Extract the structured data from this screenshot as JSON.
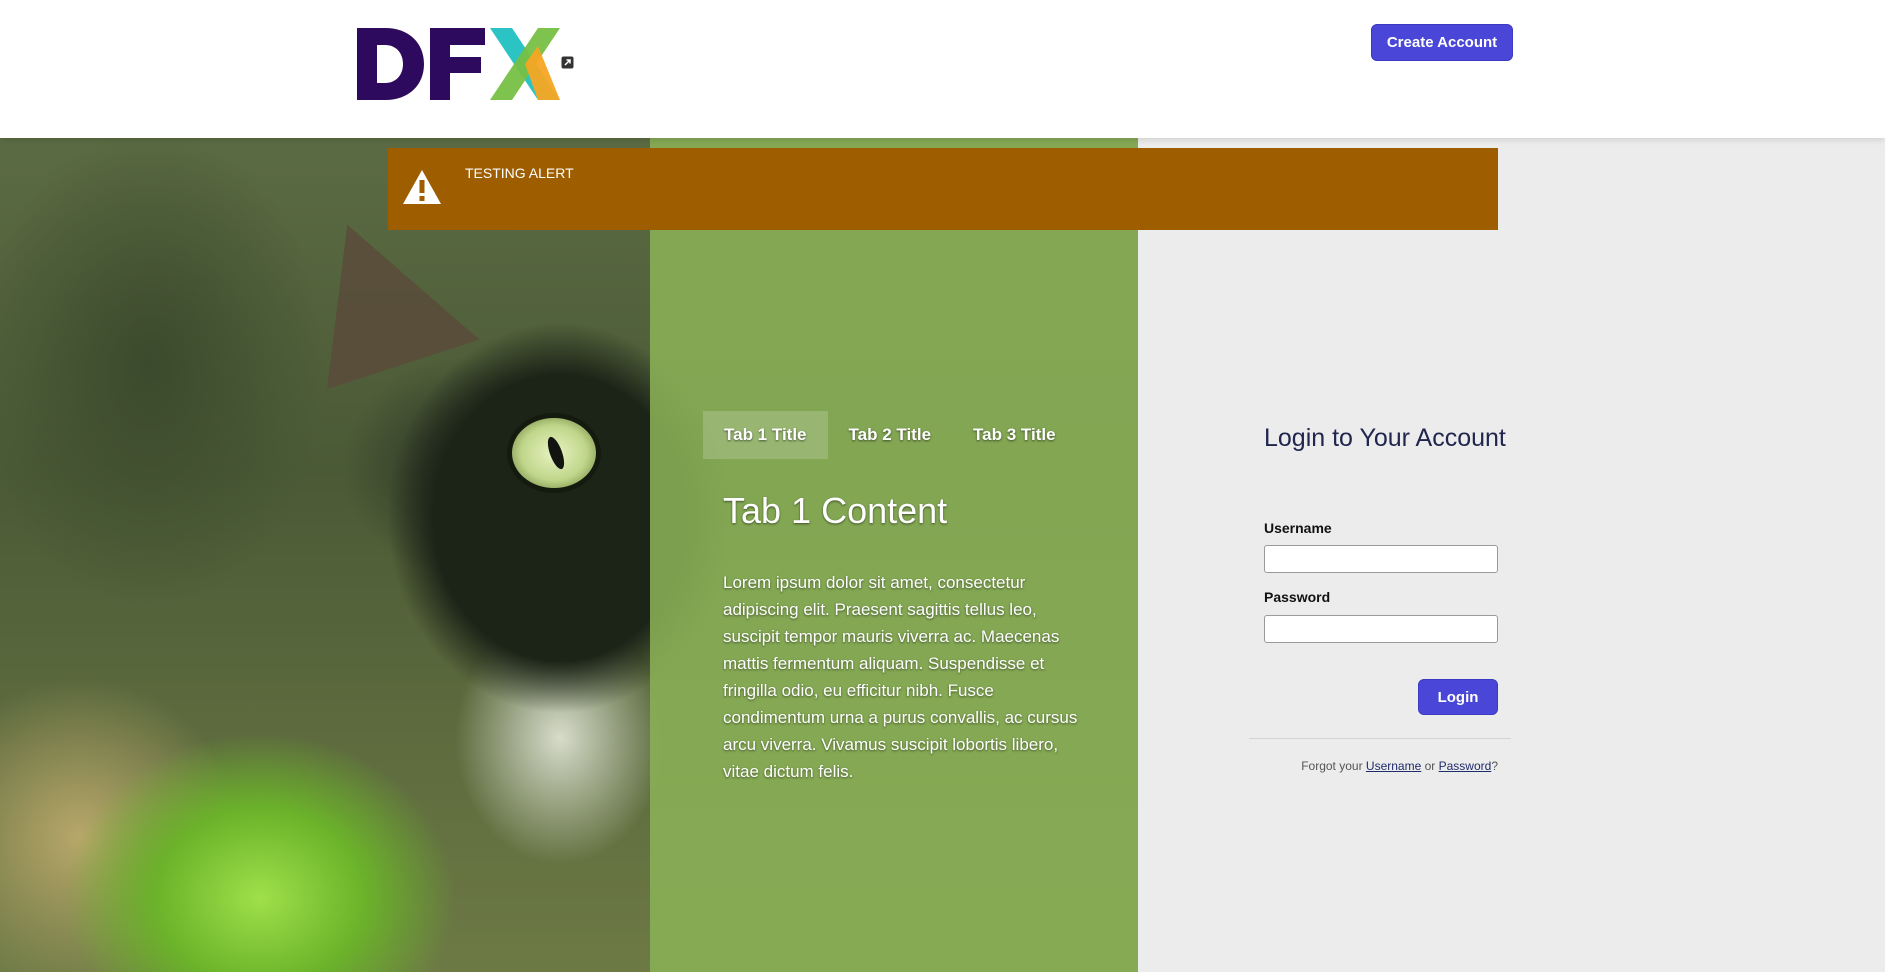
{
  "header": {
    "logo_text": "DFX",
    "create_account_label": "Create Account"
  },
  "alert": {
    "text": "TESTING ALERT",
    "icon": "warning-icon",
    "color": "#9e5e00"
  },
  "tabs": [
    {
      "label": "Tab 1 Title",
      "active": true
    },
    {
      "label": "Tab 2 Title",
      "active": false
    },
    {
      "label": "Tab 3 Title",
      "active": false
    }
  ],
  "tab_content": {
    "heading": "Tab 1 Content",
    "body": "Lorem ipsum dolor sit amet, consectetur adipiscing elit. Praesent sagittis tellus leo, suscipit tempor mauris viverra ac. Maecenas mattis fermentum aliquam. Suspendisse et fringilla odio, eu efficitur nibh. Fusce condimentum urna a purus convallis, ac cursus arcu viverra. Vivamus suscipit lobortis libero, vitae dictum felis."
  },
  "login": {
    "title": "Login to Your Account",
    "username_label": "Username",
    "username_value": "",
    "password_label": "Password",
    "password_value": "",
    "submit_label": "Login",
    "forgot_prefix": "Forgot your",
    "forgot_username": "Username",
    "forgot_or": "or",
    "forgot_password": "Password",
    "forgot_suffix": "?"
  },
  "colors": {
    "accent": "#4a47d8",
    "panel_green": "#8ab056",
    "title_navy": "#20264e",
    "logo_purple": "#2d0a5e",
    "logo_teal": "#2cc3c4",
    "logo_green": "#76c043",
    "logo_orange": "#f5a623"
  }
}
